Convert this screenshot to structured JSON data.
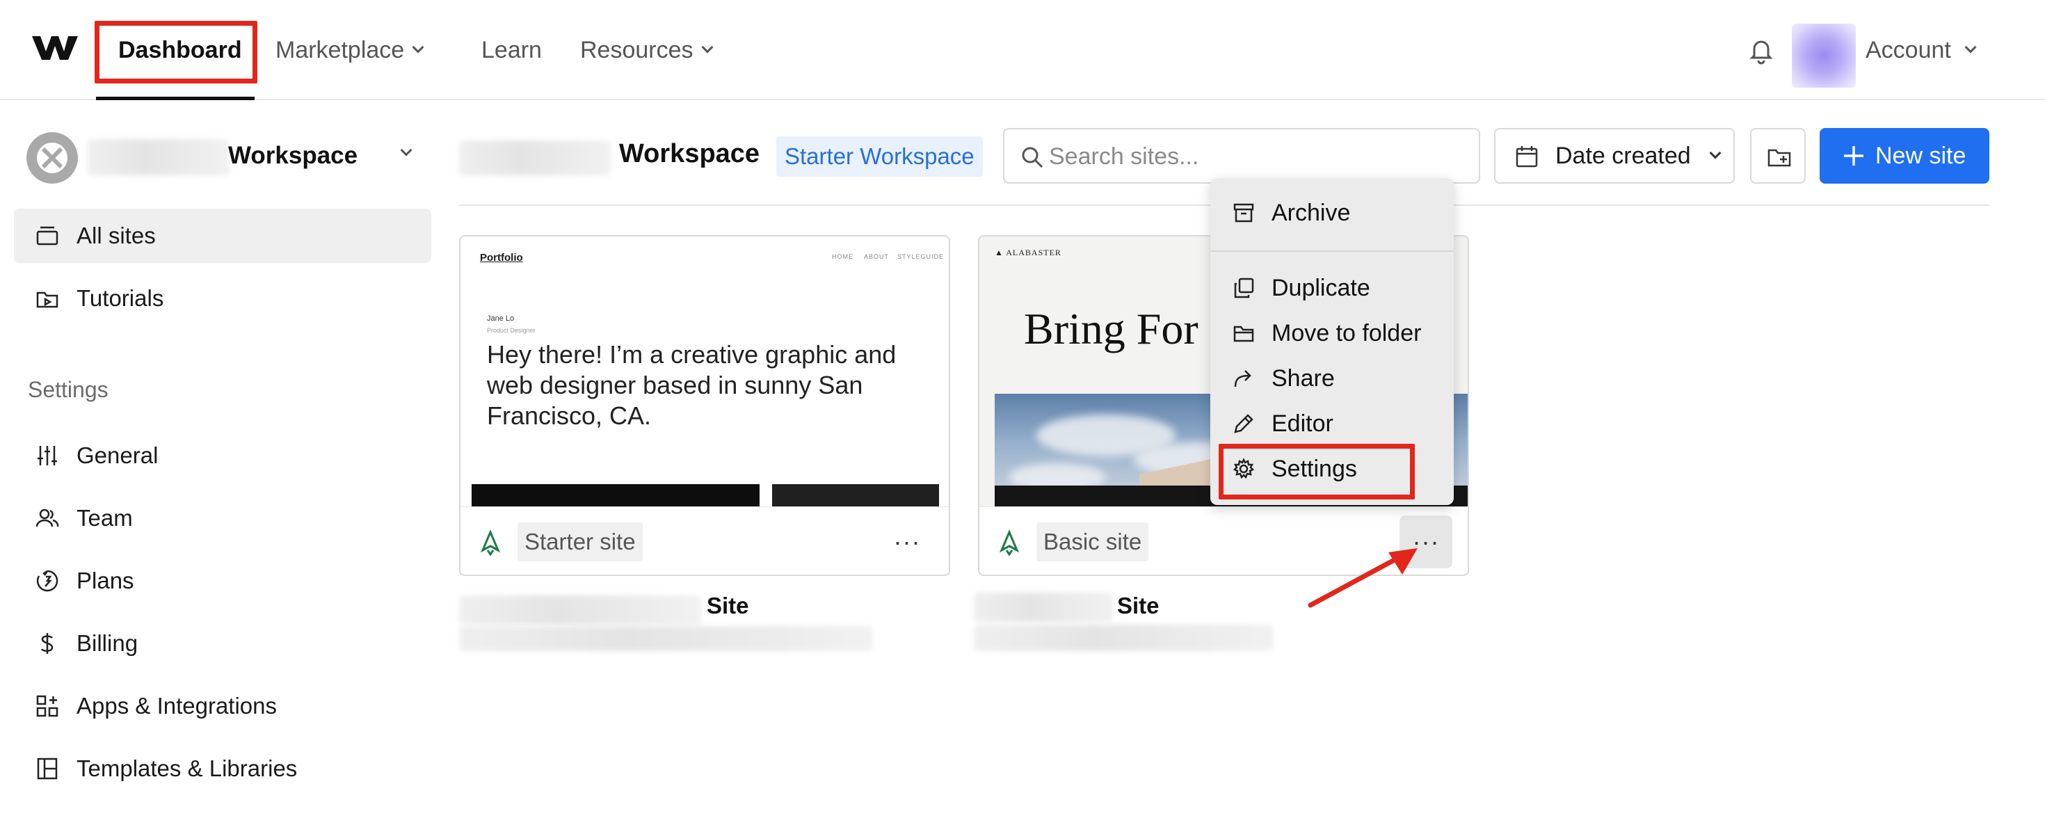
{
  "nav": {
    "logo": "webflow-logo",
    "items": [
      {
        "label": "Dashboard"
      },
      {
        "label": "Marketplace"
      },
      {
        "label": "Learn"
      },
      {
        "label": "Resources"
      }
    ],
    "account_label": "Account"
  },
  "sidebar": {
    "workspace_name": "Workspace",
    "items": [
      {
        "label": "All sites",
        "icon": "sites-icon"
      },
      {
        "label": "Tutorials",
        "icon": "tutorials-icon"
      }
    ],
    "settings_label": "Settings",
    "settings_items": [
      {
        "label": "General",
        "icon": "sliders-icon"
      },
      {
        "label": "Team",
        "icon": "team-icon"
      },
      {
        "label": "Plans",
        "icon": "plans-icon"
      },
      {
        "label": "Billing",
        "icon": "dollar-icon"
      },
      {
        "label": "Apps & Integrations",
        "icon": "apps-icon"
      },
      {
        "label": "Templates & Libraries",
        "icon": "templates-icon"
      }
    ]
  },
  "header": {
    "workspace_title": "Workspace",
    "plan_badge": "Starter Workspace",
    "search_placeholder": "Search sites...",
    "sort_label": "Date created",
    "new_site_label": "New site"
  },
  "sites": [
    {
      "name": "Site",
      "plan": "Starter site",
      "preview": {
        "logo": "Portfolio",
        "nav": [
          "HOME",
          "ABOUT",
          "STYLEGUIDE"
        ],
        "person": "Jane Lo",
        "role": "Product Designer",
        "headline": "Hey there! I’m a creative graphic and web designer based in sunny San Francisco, CA."
      }
    },
    {
      "name": "Site",
      "plan": "Basic site",
      "preview": {
        "logo": "ALABASTER",
        "headline": "Bring For"
      }
    }
  ],
  "context_menu": {
    "items": [
      {
        "label": "Archive",
        "icon": "archive-icon"
      },
      {
        "label": "Duplicate",
        "icon": "duplicate-icon"
      },
      {
        "label": "Move to folder",
        "icon": "folder-icon"
      },
      {
        "label": "Share",
        "icon": "share-icon"
      },
      {
        "label": "Editor",
        "icon": "pencil-icon"
      },
      {
        "label": "Settings",
        "icon": "gear-icon"
      }
    ]
  },
  "colors": {
    "accent": "#1f6ff0",
    "highlight": "#e3261b",
    "badge_text": "#2a6fd6"
  }
}
